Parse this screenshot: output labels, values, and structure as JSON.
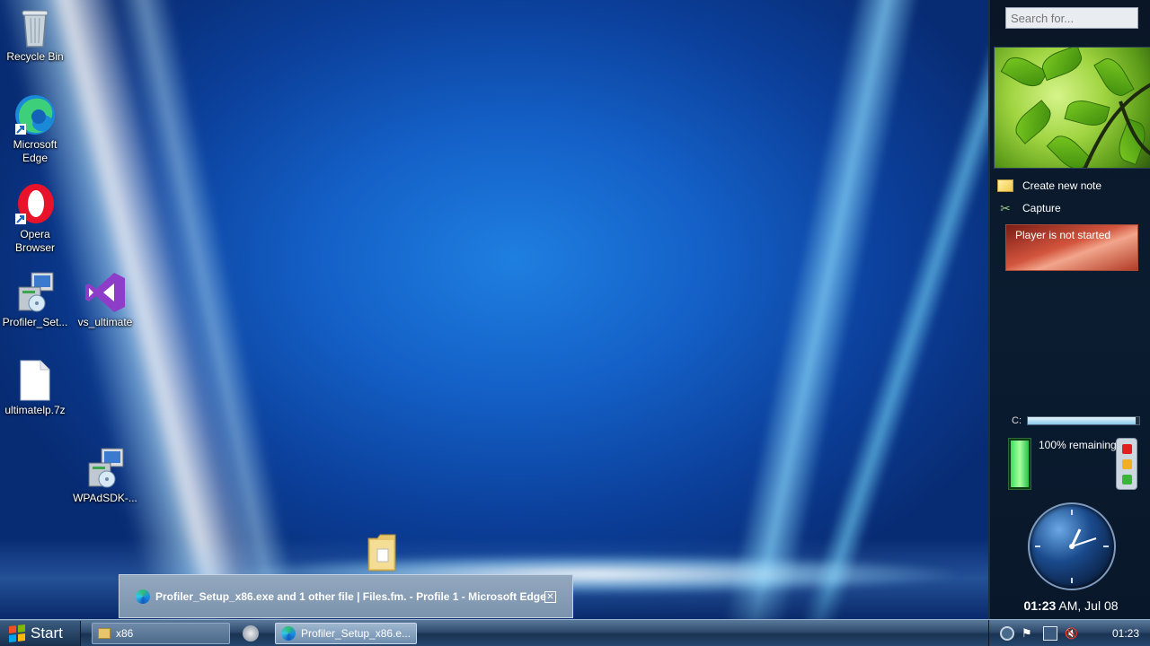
{
  "desktop": {
    "icons": [
      {
        "label": "Recycle Bin"
      },
      {
        "label": "Microsoft Edge"
      },
      {
        "label": "Opera Browser"
      },
      {
        "label": "Profiler_Set..."
      },
      {
        "label": "vs_ultimate"
      },
      {
        "label": "ultimatelp.7z"
      },
      {
        "label": "WPAdSDK-..."
      }
    ]
  },
  "sidebar": {
    "search_placeholder": "Search for...",
    "notes": {
      "create": "Create new note",
      "capture": "Capture"
    },
    "player": {
      "status": "Player is not started"
    },
    "disk": {
      "drive": "C:",
      "used_fraction": 0.97
    },
    "battery": {
      "text": "100% remaining",
      "level": 1.0
    },
    "clock": {
      "time": "01:23",
      "suffix": " AM, Jul 08"
    }
  },
  "notification": {
    "text": "Profiler_Setup_x86.exe and 1 other file | Files.fm. - Profile 1 - Microsoft Edge",
    "close": "✕"
  },
  "taskbar": {
    "start_label": "Start",
    "tasks": [
      {
        "label": "x86"
      },
      {
        "label": "Profiler_Setup_x86.e..."
      }
    ],
    "time": "01:23"
  },
  "colors": {
    "desktop_blue": "#1461c8",
    "traffic_red": "#e02020",
    "traffic_amber": "#f0b020",
    "traffic_green": "#3cb43c"
  }
}
